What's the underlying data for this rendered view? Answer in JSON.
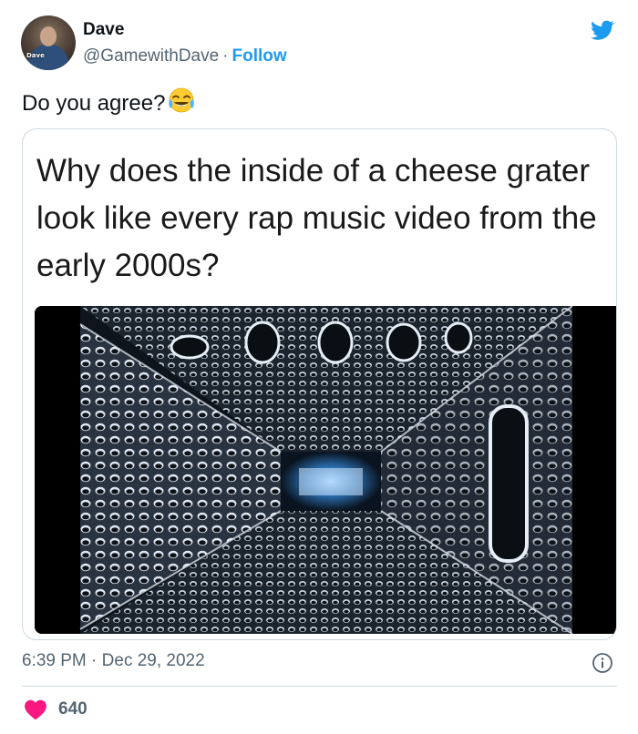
{
  "author": {
    "name": "Dave",
    "handle": "@GamewithDave",
    "separator": "·",
    "follow_label": "Follow",
    "avatar_label": "Dave"
  },
  "tweet": {
    "text": "Do you agree?",
    "emoji": "face-with-tears-of-joy"
  },
  "media_card": {
    "caption": "Why does the inside of a cheese grater look like every rap music video from the early 2000s?",
    "image": "cheese-grater-interior-photo"
  },
  "meta": {
    "time": "6:39 PM",
    "separator": "·",
    "date": "Dec 29, 2022"
  },
  "engagement": {
    "likes": "640"
  },
  "colors": {
    "accent": "#1d9bf0",
    "secondary_text": "#536471",
    "heart": "#f91880",
    "border": "#cfd9de"
  }
}
